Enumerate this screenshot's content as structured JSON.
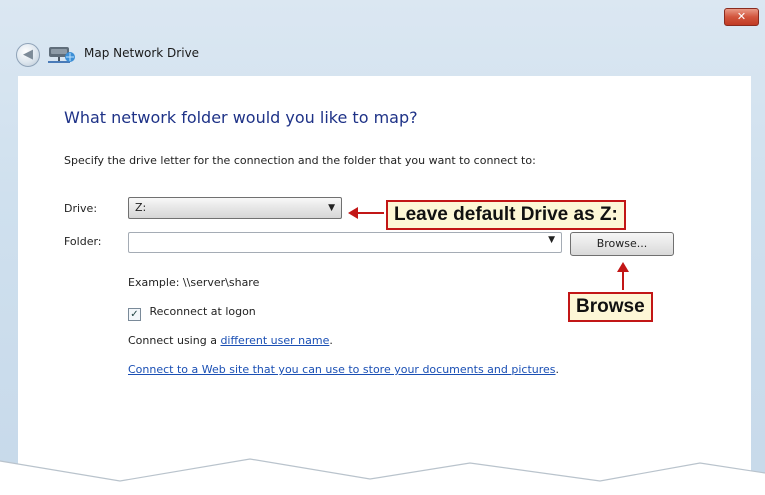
{
  "window": {
    "title": "Map Network Drive",
    "close_glyph": "✕",
    "back_glyph": "◀"
  },
  "main": {
    "heading": "What network folder would you like to map?",
    "instructions": "Specify the drive letter for the connection and the folder that you want to connect to:",
    "drive": {
      "label": "Drive:",
      "value": "Z:"
    },
    "folder": {
      "label": "Folder:",
      "value": ""
    },
    "browse_label": "Browse...",
    "example": "Example: \\\\server\\share",
    "reconnect": {
      "label": "Reconnect at logon",
      "checked": true,
      "check_glyph": "✓"
    },
    "connect_as": {
      "prefix": "Connect using a ",
      "link": "different user name",
      "suffix": "."
    },
    "web_link": "Connect to a Web site that you can use to store your documents and pictures",
    "web_link_suffix": "."
  },
  "annotations": {
    "drive_callout": "Leave default Drive as Z:",
    "browse_callout": "Browse",
    "color": "#c21616"
  },
  "icons": {
    "back": "back-arrow-icon",
    "network_drive": "network-drive-icon",
    "close": "close-icon",
    "dropdown": "chevron-down-icon"
  }
}
